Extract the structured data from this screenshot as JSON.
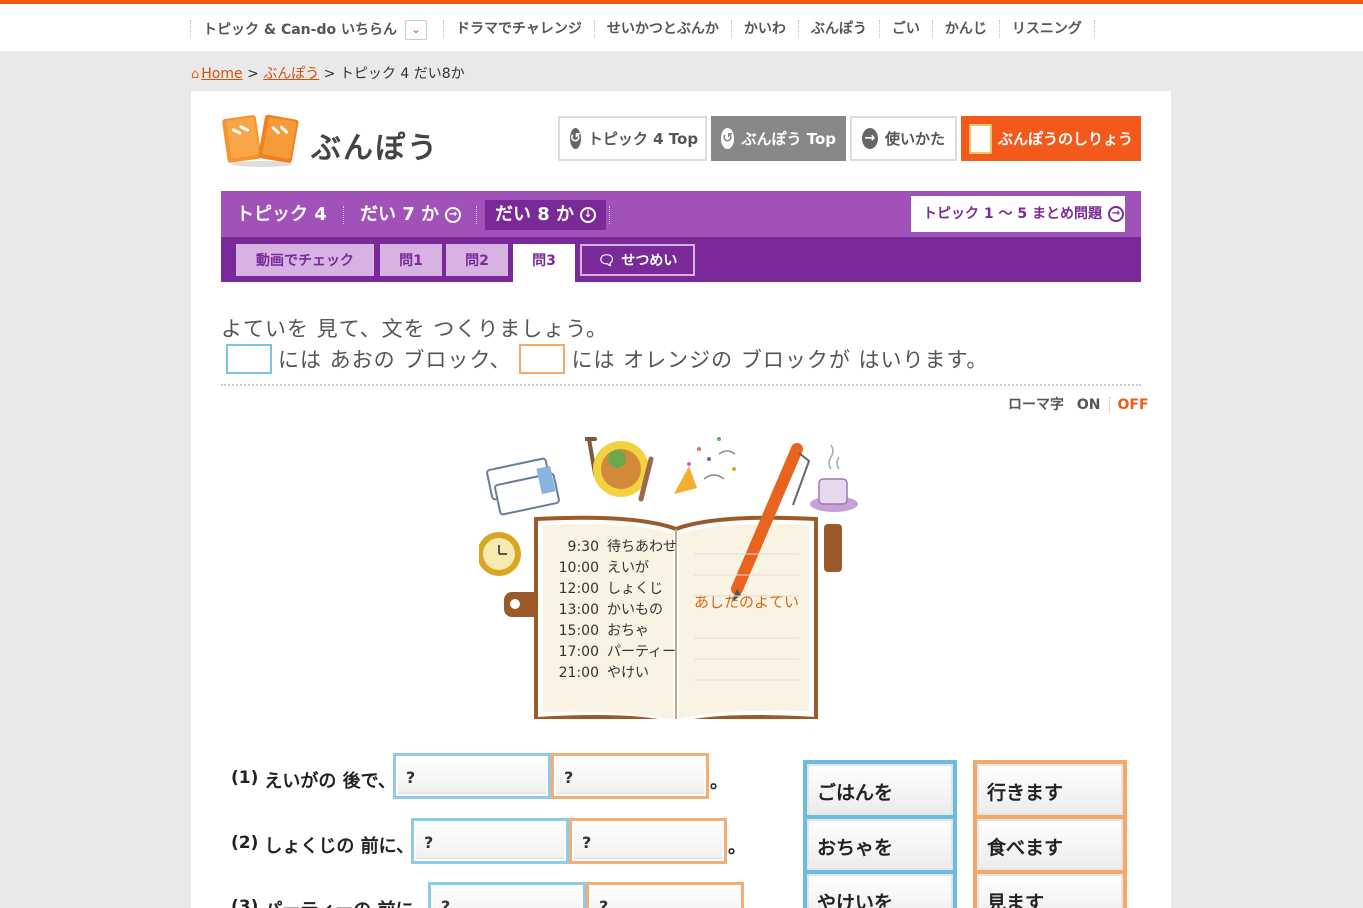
{
  "top_nav": {
    "items": [
      "トピック & Can-do いちらん",
      "ドラマでチャレンジ",
      "せいかつとぶんか",
      "かいわ",
      "ぶんぽう",
      "ごい",
      "かんじ",
      "リスニング"
    ]
  },
  "breadcrumb": {
    "home": "Home",
    "sep1": ">",
    "section": "ぶんぽう",
    "sep2": ">",
    "current": "トピック 4 だい8か"
  },
  "header": {
    "title": "ぶんぽう",
    "buttons": {
      "topic_top": "トピック 4 Top",
      "bunpou_top": "ぶんぽう Top",
      "usage": "使いかた",
      "guide": "ぶんぽうのしりょう"
    }
  },
  "lesson_nav": {
    "topic": "トピック 4",
    "lesson7": "だい 7 か",
    "lesson8": "だい 8 か",
    "summary": "トピック 1 〜 5 まとめ問題"
  },
  "tabs": {
    "video": "動画でチェック",
    "q1": "問1",
    "q2": "問2",
    "q3": "問3",
    "explain": "せつめい"
  },
  "instructions": {
    "line1": "よていを 見て、文を つくりましょう。",
    "part_a": "には あおの ブロック、",
    "part_b": "には オレンジの ブロックが はいります。"
  },
  "romaji": {
    "label": "ローマ字",
    "on": "ON",
    "off": "OFF"
  },
  "schedule": {
    "items": [
      {
        "time": "9:30",
        "event": "待ちあわせ"
      },
      {
        "time": "10:00",
        "event": "えいが"
      },
      {
        "time": "12:00",
        "event": "しょくじ"
      },
      {
        "time": "13:00",
        "event": "かいもの"
      },
      {
        "time": "15:00",
        "event": "おちゃ"
      },
      {
        "time": "17:00",
        "event": "パーティー"
      },
      {
        "time": "21:00",
        "event": "やけい"
      }
    ],
    "caption": "あしたのよてい"
  },
  "questions": [
    {
      "num": "(1)",
      "text": "えいがの 後で、",
      "slot1": "?",
      "slot2": "?",
      "end": "。"
    },
    {
      "num": "(2)",
      "text": "しょくじの 前に、",
      "slot1": "?",
      "slot2": "?",
      "end": "。"
    },
    {
      "num": "(3)",
      "text": "パーティーの 前に、",
      "slot1": "?",
      "slot2": "?",
      "end": "。"
    }
  ],
  "blue_blocks": [
    "ごはんを",
    "おちゃを",
    "やけいを"
  ],
  "orange_blocks": [
    "行きます",
    "食べます",
    "見ます"
  ],
  "colors": {
    "accent": "#f05a14",
    "purple": "#7a2a98",
    "blue_block": "#6cbbe3",
    "orange_block": "#f4a86a"
  }
}
